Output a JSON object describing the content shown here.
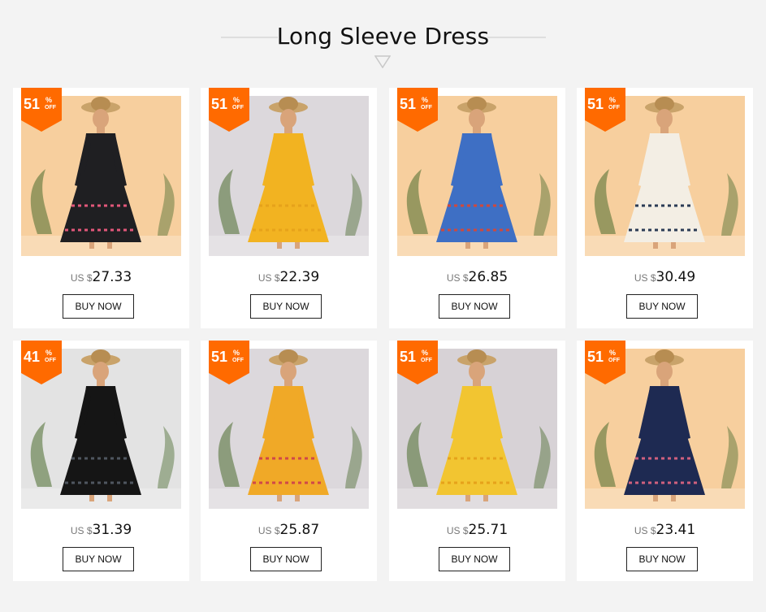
{
  "section": {
    "title": "Long Sleeve Dress"
  },
  "products": [
    {
      "discount": "51",
      "percent_sign": "%",
      "off_label": "OFF",
      "currency": "US $",
      "price": "27.33",
      "buy_label": "BUY NOW",
      "bg": "#f7cf9e",
      "dress": "#1f1f22",
      "accent": "#e2577a",
      "skin": "#d9a47a"
    },
    {
      "discount": "51",
      "percent_sign": "%",
      "off_label": "OFF",
      "currency": "US $",
      "price": "22.39",
      "buy_label": "BUY NOW",
      "bg": "#dcd8dc",
      "dress": "#f2b321",
      "accent": "#e6a21a",
      "skin": "#d9a47a"
    },
    {
      "discount": "51",
      "percent_sign": "%",
      "off_label": "OFF",
      "currency": "US $",
      "price": "26.85",
      "buy_label": "BUY NOW",
      "bg": "#f7cf9e",
      "dress": "#3e6fc4",
      "accent": "#d0483c",
      "skin": "#d9a47a"
    },
    {
      "discount": "51",
      "percent_sign": "%",
      "off_label": "OFF",
      "currency": "US $",
      "price": "30.49",
      "buy_label": "BUY NOW",
      "bg": "#f7cf9e",
      "dress": "#f3eee4",
      "accent": "#2a3b55",
      "skin": "#d9a47a"
    },
    {
      "discount": "41",
      "percent_sign": "%",
      "off_label": "OFF",
      "currency": "US $",
      "price": "31.39",
      "buy_label": "BUY NOW",
      "bg": "#e3e3e3",
      "dress": "#151515",
      "accent": "#4f5660",
      "skin": "#d9a47a"
    },
    {
      "discount": "51",
      "percent_sign": "%",
      "off_label": "OFF",
      "currency": "US $",
      "price": "25.87",
      "buy_label": "BUY NOW",
      "bg": "#dcd8dc",
      "dress": "#f0a927",
      "accent": "#d04848",
      "skin": "#d9a47a"
    },
    {
      "discount": "51",
      "percent_sign": "%",
      "off_label": "OFF",
      "currency": "US $",
      "price": "25.71",
      "buy_label": "BUY NOW",
      "bg": "#d7d2d6",
      "dress": "#f2c531",
      "accent": "#e6a21a",
      "skin": "#d9a47a"
    },
    {
      "discount": "51",
      "percent_sign": "%",
      "off_label": "OFF",
      "currency": "US $",
      "price": "23.41",
      "buy_label": "BUY NOW",
      "bg": "#f7cf9e",
      "dress": "#1e2a52",
      "accent": "#d0607e",
      "skin": "#d9a47a"
    }
  ],
  "colors": {
    "badge": "#ff6a00",
    "page_bg": "#f3f3f3",
    "card_bg": "#ffffff"
  }
}
